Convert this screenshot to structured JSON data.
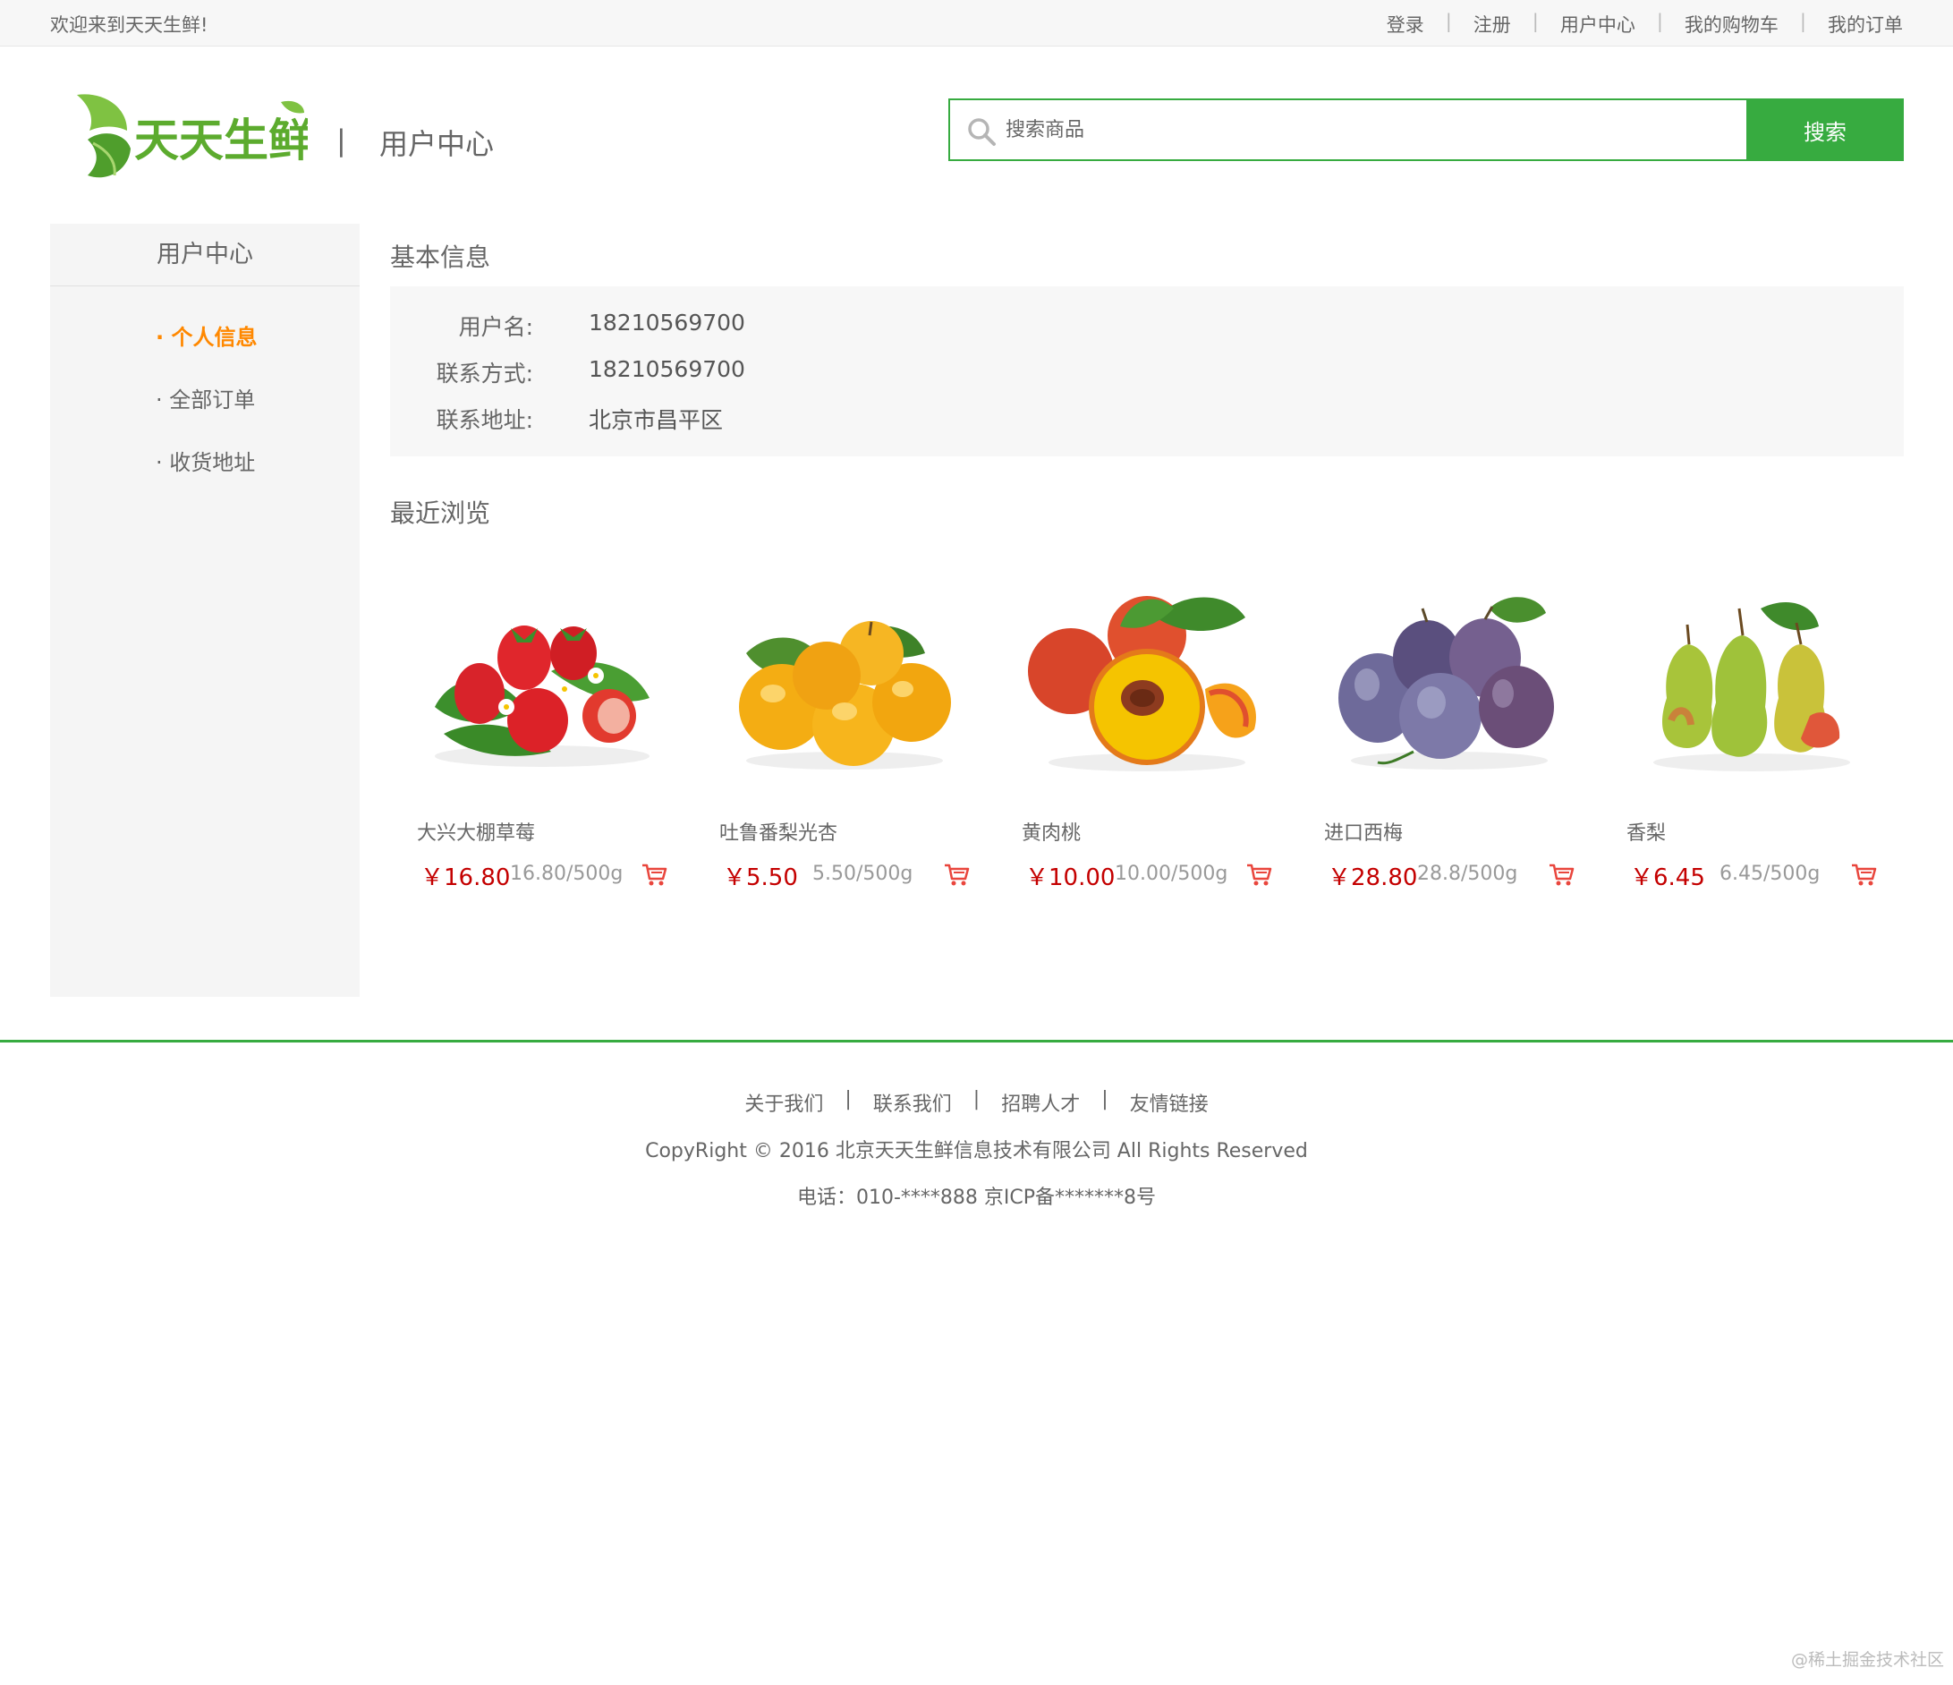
{
  "topbar": {
    "welcome": "欢迎来到天天生鲜!",
    "links": [
      "登录",
      "注册",
      "用户中心",
      "我的购物车",
      "我的订单"
    ],
    "separator": "|"
  },
  "header": {
    "logo_text": "天天生鲜",
    "separator": "|",
    "title": "用户中心"
  },
  "search": {
    "placeholder": "搜索商品",
    "button_label": "搜索",
    "icon": "search-icon"
  },
  "sidebar": {
    "title": "用户中心",
    "items": [
      {
        "label": "· 个人信息",
        "active": true
      },
      {
        "label": "· 全部订单",
        "active": false
      },
      {
        "label": "· 收货地址",
        "active": false
      }
    ]
  },
  "basic_info": {
    "title": "基本信息",
    "rows": [
      {
        "label": "用户名:",
        "value": "18210569700"
      },
      {
        "label": "联系方式:",
        "value": "18210569700"
      },
      {
        "label": "联系地址:",
        "value": "北京市昌平区"
      }
    ]
  },
  "recent": {
    "title": "最近浏览",
    "products": [
      {
        "name": "大兴大棚草莓",
        "price": "￥16.80",
        "unit": "16.80/500g",
        "image": "strawberry"
      },
      {
        "name": "吐鲁番梨光杏",
        "price": "￥5.50",
        "unit": "5.50/500g",
        "image": "apricot"
      },
      {
        "name": "黄肉桃",
        "price": "￥10.00",
        "unit": "10.00/500g",
        "image": "peach"
      },
      {
        "name": "进口西梅",
        "price": "￥28.80",
        "unit": "28.8/500g",
        "image": "plum"
      },
      {
        "name": "香梨",
        "price": "￥6.45",
        "unit": "6.45/500g",
        "image": "pear"
      }
    ]
  },
  "footer": {
    "links": [
      "关于我们",
      "联系我们",
      "招聘人才",
      "友情链接"
    ],
    "separator": "|",
    "copyright": "CopyRight © 2016 北京天天生鲜信息技术有限公司 All Rights Reserved",
    "contact": "电话：010-****888    京ICP备*******8号"
  },
  "watermark": "@稀土掘金技术社区",
  "colors": {
    "brand_green": "#37ab40",
    "active_orange": "#ff8800",
    "price_red": "#c40000"
  }
}
